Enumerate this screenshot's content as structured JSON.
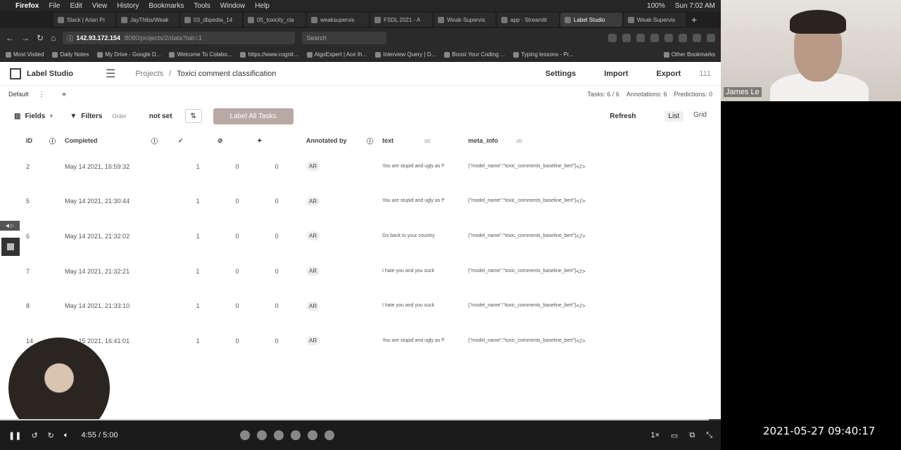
{
  "menubar": {
    "app": "Firefox",
    "items": [
      "File",
      "Edit",
      "View",
      "History",
      "Bookmarks",
      "Tools",
      "Window",
      "Help"
    ],
    "battery": "100%",
    "clock": "Sun 7:02 AM"
  },
  "tabs": [
    {
      "label": "Slack | Arian Pr"
    },
    {
      "label": "JayThibs/Weak"
    },
    {
      "label": "03_dbpedia_14"
    },
    {
      "label": "05_toxicity_cla"
    },
    {
      "label": "weaksupervis"
    },
    {
      "label": "FSDL 2021 - A"
    },
    {
      "label": "Weak-Supervis"
    },
    {
      "label": "app · Streamlit"
    },
    {
      "label": "Label Studio"
    },
    {
      "label": "Weak-Supervis"
    }
  ],
  "url": {
    "host": "142.93.172.154",
    "path": ":8080/projects/2/data?tab=1"
  },
  "search_placeholder": "Search",
  "bookmarks": [
    "Most Visited",
    "Daily Notes",
    "My Drive - Google D...",
    "Welcome To Colabo...",
    "https://www.cognit...",
    "AlgoExpert | Ace th...",
    "Interview Query | D...",
    "Boost Your Coding ...",
    "Typing lessons - Pr..."
  ],
  "bookmarks_other": "Other Bookmarks",
  "header": {
    "logo": "Label Studio",
    "crumb_projects": "Projects",
    "crumb_sep": "/",
    "crumb_current": "Toxici comment classification",
    "nav_settings": "Settings",
    "nav_import": "Import",
    "nav_export": "Export",
    "user": "111"
  },
  "view": {
    "tab": "Default",
    "tab_menu": "⋮",
    "add": "+",
    "stats": [
      "Tasks: 6 / 6",
      "Annotations: 6",
      "Predictions: 0"
    ]
  },
  "toolbar": {
    "fields": "Fields",
    "filters": "Filters",
    "order": "Order",
    "not_set": "not set",
    "label_all": "Label All Tasks",
    "refresh": "Refresh",
    "list": "List",
    "grid": "Grid"
  },
  "columns": {
    "id": "ID",
    "completed": "Completed",
    "annotated_by": "Annotated by",
    "text": "text",
    "text_type": "str",
    "meta": "meta_info",
    "meta_type": "str"
  },
  "rows": [
    {
      "id": "2",
      "completed": "May 14 2021, 16:59:32",
      "n1": "1",
      "n2": "0",
      "n3": "0",
      "annotator": "AR",
      "text": "You are stupid and ugly as f*",
      "meta": "{\"model_name\":\"toxic_comments_baseline_bert\"}",
      "code": "</>"
    },
    {
      "id": "5",
      "completed": "May 14 2021, 21:30:44",
      "n1": "1",
      "n2": "0",
      "n3": "0",
      "annotator": "AR",
      "text": "You are stupid and ugly as f*",
      "meta": "{\"model_name\":\"toxic_comments_baseline_bert\"}",
      "code": "</>"
    },
    {
      "id": "6",
      "completed": "May 14 2021, 21:32:02",
      "n1": "1",
      "n2": "0",
      "n3": "0",
      "annotator": "AR",
      "text": "Go back to your country",
      "meta": "{\"model_name\":\"toxic_comments_baseline_bert\"}",
      "code": "</>"
    },
    {
      "id": "7",
      "completed": "May 14 2021, 21:32:21",
      "n1": "1",
      "n2": "0",
      "n3": "0",
      "annotator": "AR",
      "text": "I hate you and you suck",
      "meta": "{\"model_name\":\"toxic_comments_baseline_bert\"}",
      "code": "</>"
    },
    {
      "id": "8",
      "completed": "May 14 2021, 21:33:10",
      "n1": "1",
      "n2": "0",
      "n3": "0",
      "annotator": "AR",
      "text": "I hate you and you suck",
      "meta": "{\"model_name\":\"toxic_comments_baseline_bert\"}",
      "code": "</>"
    },
    {
      "id": "14",
      "completed": "May 15 2021, 16:41:01",
      "n1": "1",
      "n2": "0",
      "n3": "0",
      "annotator": "AR",
      "text": "You are stupid and ugly as f*",
      "meta": "{\"model_name\":\"toxic_comments_baseline_bert\"}",
      "code": "</>"
    }
  ],
  "player": {
    "time": "4:55 / 5:00",
    "speed": "1×",
    "progress": 0.983
  },
  "webcam_name": "James Le",
  "recording_timestamp": "2021-05-27 09:40:17"
}
